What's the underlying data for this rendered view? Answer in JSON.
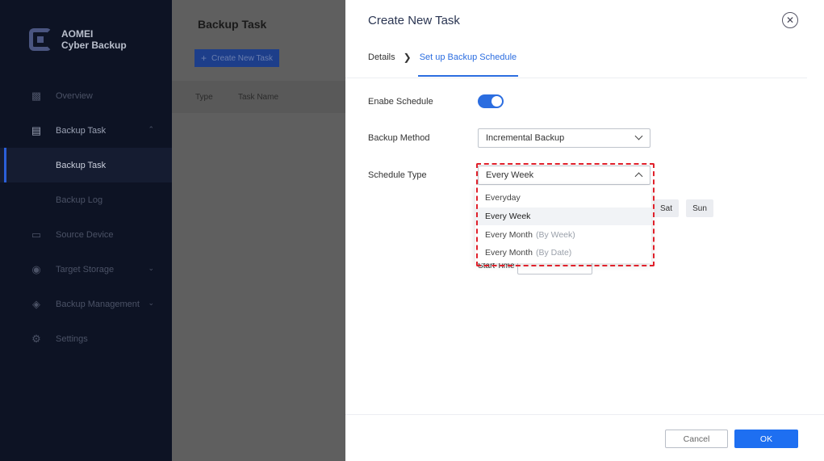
{
  "app": {
    "brand_line1": "AOMEI",
    "brand_line2": "Cyber Backup"
  },
  "sidebar": {
    "items": [
      {
        "label": "Overview",
        "icon": "overview-icon"
      },
      {
        "label": "Backup Task",
        "icon": "clipboard-icon"
      },
      {
        "label": "Backup Task",
        "icon": ""
      },
      {
        "label": "Backup Log",
        "icon": ""
      },
      {
        "label": "Source Device",
        "icon": "monitor-icon"
      },
      {
        "label": "Target Storage",
        "icon": "location-pin-icon"
      },
      {
        "label": "Backup Management",
        "icon": "layers-icon"
      },
      {
        "label": "Settings",
        "icon": "gear-icon"
      }
    ]
  },
  "main": {
    "title": "Backup Task",
    "new_task_button": "Create New Task",
    "columns": [
      "Type",
      "Task Name"
    ]
  },
  "dialog": {
    "title": "Create New Task",
    "steps": [
      "Details",
      "Set up Backup Schedule"
    ],
    "enable_schedule_label": "Enabe Schedule",
    "enable_schedule_on": true,
    "backup_method_label": "Backup Method",
    "backup_method_value": "Incremental Backup",
    "schedule_type_label": "Schedule Type",
    "schedule_type_value": "Every Week",
    "schedule_options": [
      {
        "label": "Everyday",
        "suffix": ""
      },
      {
        "label": "Every Week",
        "suffix": ""
      },
      {
        "label": "Every Month",
        "suffix": "(By Week)"
      },
      {
        "label": "Every Month",
        "suffix": "(By Date)"
      }
    ],
    "days_visible": [
      "Sat",
      "Sun"
    ],
    "start_time_label": "Start Time",
    "cancel_button": "Cancel",
    "ok_button": "OK"
  },
  "colors": {
    "accent": "#2b6de0",
    "primary_button": "#1e6ff1",
    "sidebar_bg": "#0d1324",
    "highlight": "#e0212b"
  }
}
